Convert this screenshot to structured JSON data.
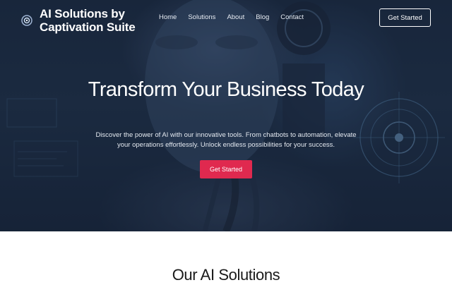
{
  "header": {
    "logo_text": "AI Solutions by Captivation Suite",
    "nav": [
      "Home",
      "Solutions",
      "About",
      "Blog",
      "Contact"
    ],
    "cta_label": "Get Started"
  },
  "hero": {
    "headline": "Transform Your Business Today",
    "subtext": "Discover the power of AI with our innovative tools. From chatbots to automation, elevate your operations effortlessly. Unlock endless possibilities for your success.",
    "cta_label": "Get Started",
    "accent_color": "#e0294f",
    "background_description_icon": "ai-robot-woman-image"
  },
  "solutions": {
    "title": "Our AI Solutions"
  }
}
